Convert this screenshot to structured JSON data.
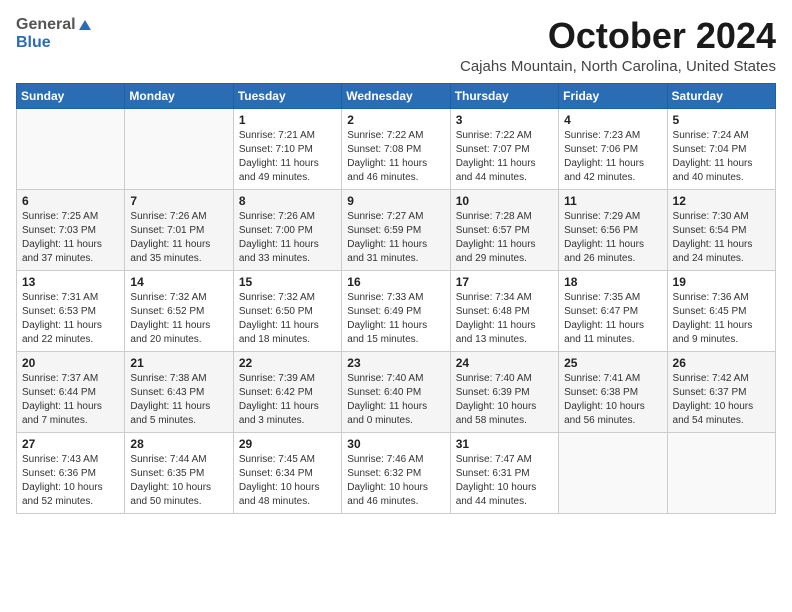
{
  "header": {
    "logo_general": "General",
    "logo_blue": "Blue",
    "month_title": "October 2024",
    "location": "Cajahs Mountain, North Carolina, United States"
  },
  "weekdays": [
    "Sunday",
    "Monday",
    "Tuesday",
    "Wednesday",
    "Thursday",
    "Friday",
    "Saturday"
  ],
  "weeks": [
    [
      {
        "day": "",
        "info": ""
      },
      {
        "day": "",
        "info": ""
      },
      {
        "day": "1",
        "info": "Sunrise: 7:21 AM\nSunset: 7:10 PM\nDaylight: 11 hours and 49 minutes."
      },
      {
        "day": "2",
        "info": "Sunrise: 7:22 AM\nSunset: 7:08 PM\nDaylight: 11 hours and 46 minutes."
      },
      {
        "day": "3",
        "info": "Sunrise: 7:22 AM\nSunset: 7:07 PM\nDaylight: 11 hours and 44 minutes."
      },
      {
        "day": "4",
        "info": "Sunrise: 7:23 AM\nSunset: 7:06 PM\nDaylight: 11 hours and 42 minutes."
      },
      {
        "day": "5",
        "info": "Sunrise: 7:24 AM\nSunset: 7:04 PM\nDaylight: 11 hours and 40 minutes."
      }
    ],
    [
      {
        "day": "6",
        "info": "Sunrise: 7:25 AM\nSunset: 7:03 PM\nDaylight: 11 hours and 37 minutes."
      },
      {
        "day": "7",
        "info": "Sunrise: 7:26 AM\nSunset: 7:01 PM\nDaylight: 11 hours and 35 minutes."
      },
      {
        "day": "8",
        "info": "Sunrise: 7:26 AM\nSunset: 7:00 PM\nDaylight: 11 hours and 33 minutes."
      },
      {
        "day": "9",
        "info": "Sunrise: 7:27 AM\nSunset: 6:59 PM\nDaylight: 11 hours and 31 minutes."
      },
      {
        "day": "10",
        "info": "Sunrise: 7:28 AM\nSunset: 6:57 PM\nDaylight: 11 hours and 29 minutes."
      },
      {
        "day": "11",
        "info": "Sunrise: 7:29 AM\nSunset: 6:56 PM\nDaylight: 11 hours and 26 minutes."
      },
      {
        "day": "12",
        "info": "Sunrise: 7:30 AM\nSunset: 6:54 PM\nDaylight: 11 hours and 24 minutes."
      }
    ],
    [
      {
        "day": "13",
        "info": "Sunrise: 7:31 AM\nSunset: 6:53 PM\nDaylight: 11 hours and 22 minutes."
      },
      {
        "day": "14",
        "info": "Sunrise: 7:32 AM\nSunset: 6:52 PM\nDaylight: 11 hours and 20 minutes."
      },
      {
        "day": "15",
        "info": "Sunrise: 7:32 AM\nSunset: 6:50 PM\nDaylight: 11 hours and 18 minutes."
      },
      {
        "day": "16",
        "info": "Sunrise: 7:33 AM\nSunset: 6:49 PM\nDaylight: 11 hours and 15 minutes."
      },
      {
        "day": "17",
        "info": "Sunrise: 7:34 AM\nSunset: 6:48 PM\nDaylight: 11 hours and 13 minutes."
      },
      {
        "day": "18",
        "info": "Sunrise: 7:35 AM\nSunset: 6:47 PM\nDaylight: 11 hours and 11 minutes."
      },
      {
        "day": "19",
        "info": "Sunrise: 7:36 AM\nSunset: 6:45 PM\nDaylight: 11 hours and 9 minutes."
      }
    ],
    [
      {
        "day": "20",
        "info": "Sunrise: 7:37 AM\nSunset: 6:44 PM\nDaylight: 11 hours and 7 minutes."
      },
      {
        "day": "21",
        "info": "Sunrise: 7:38 AM\nSunset: 6:43 PM\nDaylight: 11 hours and 5 minutes."
      },
      {
        "day": "22",
        "info": "Sunrise: 7:39 AM\nSunset: 6:42 PM\nDaylight: 11 hours and 3 minutes."
      },
      {
        "day": "23",
        "info": "Sunrise: 7:40 AM\nSunset: 6:40 PM\nDaylight: 11 hours and 0 minutes."
      },
      {
        "day": "24",
        "info": "Sunrise: 7:40 AM\nSunset: 6:39 PM\nDaylight: 10 hours and 58 minutes."
      },
      {
        "day": "25",
        "info": "Sunrise: 7:41 AM\nSunset: 6:38 PM\nDaylight: 10 hours and 56 minutes."
      },
      {
        "day": "26",
        "info": "Sunrise: 7:42 AM\nSunset: 6:37 PM\nDaylight: 10 hours and 54 minutes."
      }
    ],
    [
      {
        "day": "27",
        "info": "Sunrise: 7:43 AM\nSunset: 6:36 PM\nDaylight: 10 hours and 52 minutes."
      },
      {
        "day": "28",
        "info": "Sunrise: 7:44 AM\nSunset: 6:35 PM\nDaylight: 10 hours and 50 minutes."
      },
      {
        "day": "29",
        "info": "Sunrise: 7:45 AM\nSunset: 6:34 PM\nDaylight: 10 hours and 48 minutes."
      },
      {
        "day": "30",
        "info": "Sunrise: 7:46 AM\nSunset: 6:32 PM\nDaylight: 10 hours and 46 minutes."
      },
      {
        "day": "31",
        "info": "Sunrise: 7:47 AM\nSunset: 6:31 PM\nDaylight: 10 hours and 44 minutes."
      },
      {
        "day": "",
        "info": ""
      },
      {
        "day": "",
        "info": ""
      }
    ]
  ]
}
